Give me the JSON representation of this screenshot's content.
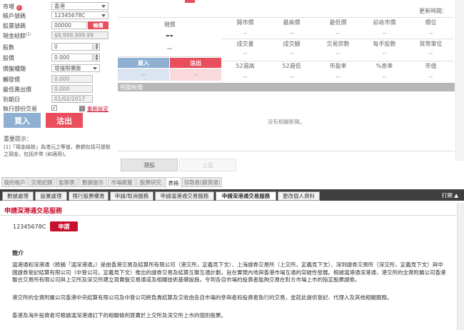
{
  "order_form": {
    "market_label": "市場",
    "market_value": "香港",
    "account_label": "帳戶號碼",
    "account_value": "12345678C",
    "stock_label": "股票號碼",
    "stock_value": "00000",
    "stock_button": "輸價",
    "cash_label": "現金結餘",
    "cash_sup": "(1)",
    "cash_value": "$9,999,999.99",
    "qty_label": "股數",
    "qty_value": "0",
    "price_label": "股價",
    "price_value": "0.000",
    "type_label": "價盤種類",
    "type_value": "增強限價盤",
    "trigger_label": "觸發價",
    "trigger_value": "0.000",
    "lowsell_label": "最低賣出價",
    "lowsell_value": "0.000",
    "expiry_label": "到期日",
    "expiry_value": "01/02/2017",
    "partial_label": "執行部份交易",
    "buy_button": "買入",
    "sell_button": "沽出",
    "reset_link": "重新設定",
    "notes_title": "重要提示：",
    "note_1": "(1)「現金結餘」為港元之等值，數額包括可提取之現金，包括外幣 (如適用)。"
  },
  "quote": {
    "refresh_label": "更新時間：",
    "price_title": "現價",
    "price_main": "--",
    "price_sub": "--",
    "buy_label": "買入",
    "sell_label": "沽出",
    "buy_val": "--",
    "sell_val": "--",
    "row1_headers": [
      "開市價",
      "最高價",
      "最低價",
      "前收市價",
      "價位"
    ],
    "row1_values": [
      "--",
      "--",
      "--",
      "--",
      "--"
    ],
    "row2_headers": [
      "成交量",
      "成交額",
      "交易宗數",
      "每手股數",
      "貨幣單位"
    ],
    "row2_values": [
      "--",
      "--",
      "--",
      "--",
      "--"
    ],
    "row3_headers": [
      "52週高",
      "52週低",
      "市盈率",
      "%息率",
      "市值"
    ],
    "row3_values": [
      "--",
      "--",
      "--",
      "--",
      "--"
    ],
    "news_title": "相關新聞",
    "news_empty": "沒有相關新聞。",
    "bottom_tabs": [
      "港股",
      "上証"
    ]
  },
  "top_tabs": [
    "我的帳戶",
    "交易紀錄",
    "監察表",
    "數據提示",
    "市場概覽",
    "股票研究",
    "表格",
    "存款易(銀貸通)"
  ],
  "form_tabs": [
    "數據處理",
    "設置處理",
    "限行股票權責",
    "申請/取消服務",
    "申請滬港通交易服務",
    "申請深港通交易服務",
    "更改個人資料"
  ],
  "print_label": "打開 ▲",
  "section": {
    "title": "申請深港通交易服務",
    "account": "12345678C",
    "apply_button": "申請",
    "intro_title": "簡介",
    "para1": "滬港通和深港通（統稱「滬深港通」）是由香港交易及結算所有限公司（港交所，定義見下文）、上海證券交易所（上交所，定義見下文）、深圳證券交易所（深交所，定義見下文）與中國證券登記結算有限公司（中登公司，定義見下文）推出的證券交易及結算互聯互通計劃，旨在實現內地與香港市場互通的突破性發展。根據滬港通深港通，港交所的全資附屬公司香港聯合交易所有限公司與上交所及深交所建立買賣盤交易通道及相關技術基礎設施，令到各自市場的投資者能夠交易在對方市場上市的指定股票證券。",
    "para2": "港交所的全資附屬公司香港中央結算有限公司及中登公司將負責結算及交收由各自市場的參與者和投資者執行的交易，並就此提供登記、代理人及其他相關服務。",
    "para3": "香港及海外投資者可根據滬深港通訂下的相關條例買賣於上交所及深交所上市的個別股票。"
  },
  "colors": {
    "red": "#e84e5b",
    "blue": "#8fb0d3",
    "section_title": "#c8102e",
    "dark_bar": "#3f3f3f"
  }
}
